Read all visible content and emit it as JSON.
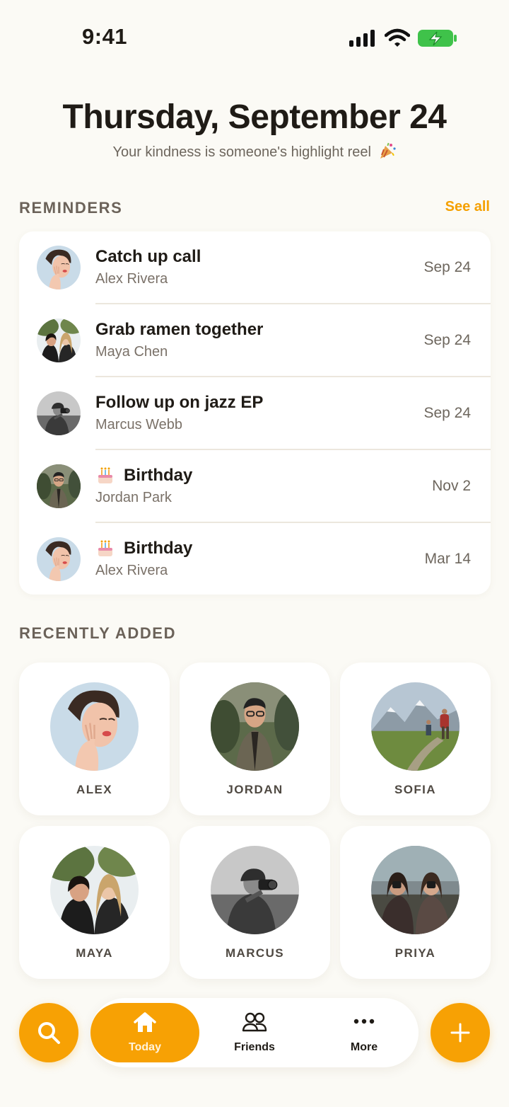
{
  "status_bar": {
    "time": "9:41",
    "signal_icon": "cellular-signal-icon",
    "wifi_icon": "wifi-icon",
    "battery_icon": "battery-charging-icon",
    "battery_color": "#3fc24a"
  },
  "header": {
    "date": "Thursday, September 24",
    "subtitle": "Your kindness is someone's highlight reel",
    "subtitle_emoji": "party-popper-icon"
  },
  "reminders": {
    "section_title": "REMINDERS",
    "see_all": "See all",
    "items": [
      {
        "title": "Catch up call",
        "name": "Alex Rivera",
        "date": "Sep 24",
        "birthday": false,
        "avatar": "alex-avatar"
      },
      {
        "title": "Grab ramen together",
        "name": "Maya Chen",
        "date": "Sep 24",
        "birthday": false,
        "avatar": "maya-avatar"
      },
      {
        "title": "Follow up on jazz EP",
        "name": "Marcus Webb",
        "date": "Sep 24",
        "birthday": false,
        "avatar": "marcus-avatar"
      },
      {
        "title": "Birthday",
        "name": "Jordan Park",
        "date": "Nov 2",
        "birthday": true,
        "avatar": "jordan-avatar"
      },
      {
        "title": "Birthday",
        "name": "Alex Rivera",
        "date": "Mar 14",
        "birthday": true,
        "avatar": "alex-avatar"
      }
    ]
  },
  "recently_added": {
    "section_title": "RECENTLY ADDED",
    "friends": [
      {
        "name": "ALEX",
        "photo": "alex-photo"
      },
      {
        "name": "JORDAN",
        "photo": "jordan-photo"
      },
      {
        "name": "SOFIA",
        "photo": "sofia-photo"
      },
      {
        "name": "MAYA",
        "photo": "maya-photo"
      },
      {
        "name": "MARCUS",
        "photo": "marcus-photo"
      },
      {
        "name": "PRIYA",
        "photo": "priya-photo"
      }
    ]
  },
  "bottom_bar": {
    "search_icon": "search-icon",
    "add_icon": "plus-icon",
    "tabs": [
      {
        "label": "Today",
        "icon": "home-icon",
        "active": true
      },
      {
        "label": "Friends",
        "icon": "friends-icon",
        "active": false
      },
      {
        "label": "More",
        "icon": "more-dots-icon",
        "active": false
      }
    ]
  },
  "colors": {
    "accent": "#f7a104",
    "background": "#fbfaf5",
    "card": "#ffffff",
    "text_primary": "#1f1b16",
    "text_secondary": "#7a7168"
  }
}
